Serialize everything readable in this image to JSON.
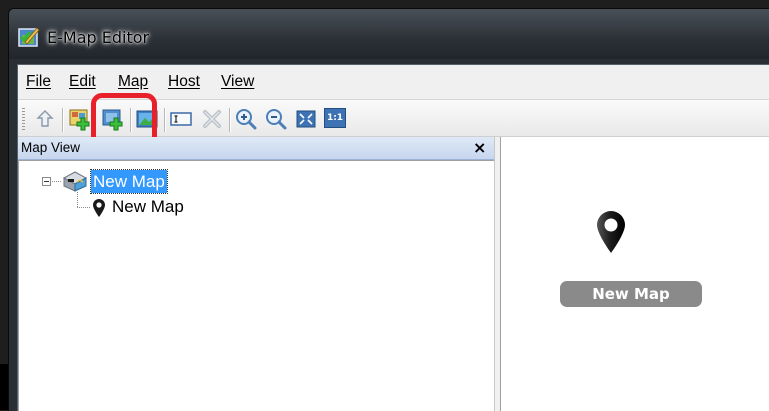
{
  "window": {
    "title": "E-Map Editor",
    "app_icon": "emap-editor-icon"
  },
  "menu": [
    "File",
    "Edit",
    "Map",
    "Host",
    "View"
  ],
  "toolbar": {
    "buttons": [
      {
        "icon": "up-level-icon"
      },
      {
        "icon": "add-map-icon",
        "highlighted": true
      },
      {
        "icon": "add-submap-icon"
      },
      {
        "icon": "map-image-icon"
      },
      {
        "icon": "rename-icon"
      },
      {
        "icon": "delete-icon"
      },
      {
        "icon": "zoom-in-icon"
      },
      {
        "icon": "zoom-out-icon"
      },
      {
        "icon": "fit-to-window-icon"
      },
      {
        "icon": "actual-size-icon",
        "text": "1:1"
      }
    ],
    "highlight_color": "#e8202a"
  },
  "map_view": {
    "title": "Map View",
    "close": "×",
    "tree": {
      "root": {
        "label": "New Map",
        "icon": "map-folder-icon",
        "expanded": true,
        "selected": true
      },
      "children": [
        {
          "label": "New Map",
          "icon": "location-pin-icon"
        }
      ]
    }
  },
  "canvas": {
    "marker": {
      "label": "New Map",
      "icon": "location-pin-icon"
    }
  },
  "colors": {
    "selection": "#3399ff",
    "marker_label_bg": "#8a8a8a"
  }
}
